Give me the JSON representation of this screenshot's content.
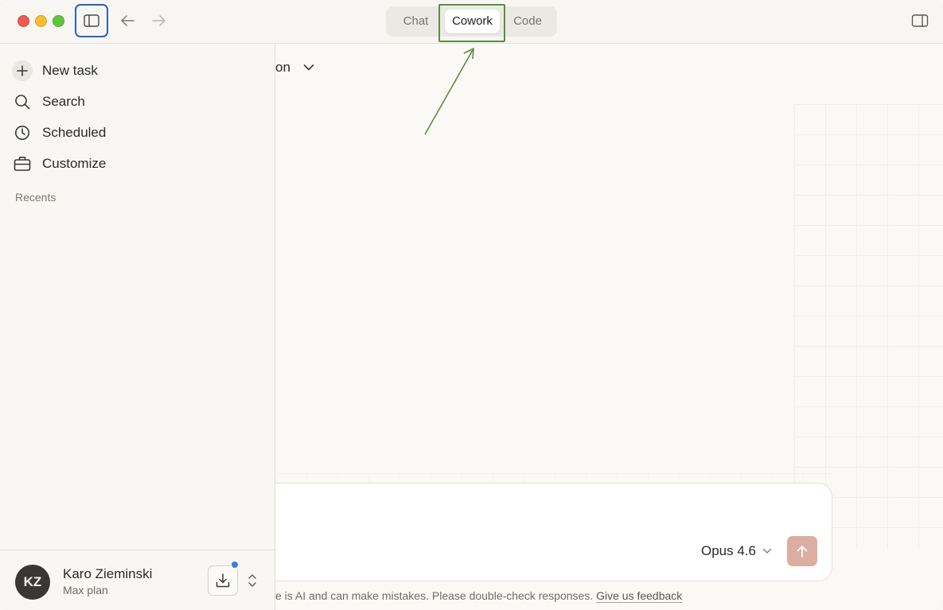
{
  "titlebar": {
    "modes": [
      {
        "label": "Chat",
        "active": false
      },
      {
        "label": "Cowork",
        "active": true
      },
      {
        "label": "Code",
        "active": false
      }
    ]
  },
  "sidebar": {
    "items": [
      {
        "label": "New task",
        "icon": "plus-icon"
      },
      {
        "label": "Search",
        "icon": "search-icon"
      },
      {
        "label": "Scheduled",
        "icon": "clock-icon"
      },
      {
        "label": "Customize",
        "icon": "briefcase-icon"
      }
    ],
    "recents_label": "Recents",
    "user": {
      "initials": "KZ",
      "name": "Karo Zieminski",
      "plan": "Max plan"
    }
  },
  "main": {
    "project_fragment": "on",
    "composer": {
      "model": "Opus 4.6"
    },
    "disclaimer": "e is AI and can make mistakes. Please double-check responses.",
    "feedback_link": "Give us feedback"
  },
  "colors": {
    "highlight_box": "#5a8f3e",
    "sidebar_toggle_outline": "#2c62b8",
    "send_button": "#dcaea2",
    "notification_dot": "#3f7ddf"
  }
}
